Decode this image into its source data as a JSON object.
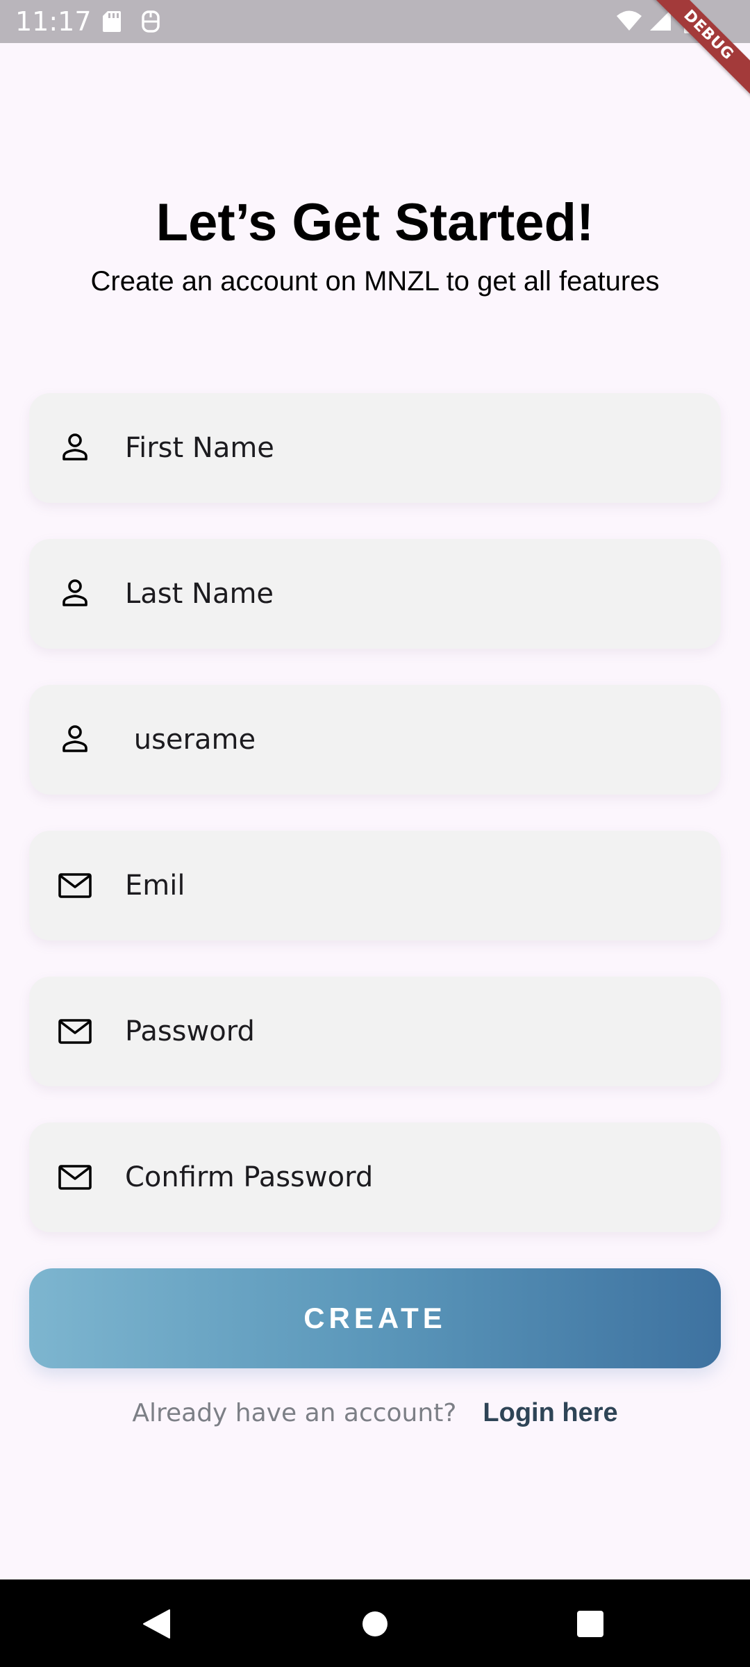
{
  "status_bar": {
    "time": "11:17"
  },
  "debug_banner": {
    "label": "DEBUG"
  },
  "header": {
    "title": "Let’s Get Started!",
    "subtitle": "Create an account on MNZL to get all features"
  },
  "form": {
    "fields": [
      {
        "icon": "person-icon",
        "placeholder": "First Name"
      },
      {
        "icon": "person-icon",
        "placeholder": "Last Name"
      },
      {
        "icon": "person-icon",
        "placeholder": " userame"
      },
      {
        "icon": "mail-icon",
        "placeholder": "Emil"
      },
      {
        "icon": "mail-icon",
        "placeholder": "Password"
      },
      {
        "icon": "mail-icon",
        "placeholder": "Confirm Password"
      }
    ],
    "create_label": "CREATE"
  },
  "login": {
    "prompt": "Already have an account?",
    "link_label": "Login here"
  },
  "colors": {
    "background": "#fcf6fd",
    "field_background": "#f2f2f2",
    "button_gradient_start": "#7db5cf",
    "button_gradient_end": "#3e72a0",
    "login_link": "#2e4456",
    "debug_banner": "#a33a3a"
  }
}
